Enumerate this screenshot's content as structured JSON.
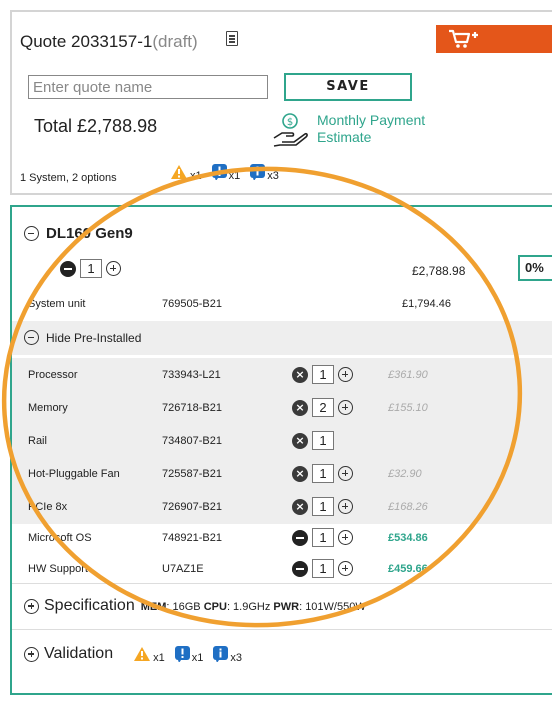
{
  "quote": {
    "title": "Quote 2033157-1",
    "draft": "(draft)",
    "name_placeholder": "Enter quote name",
    "name_value": "",
    "save_label": "SAVE",
    "total": "Total £2,788.98",
    "monthly_label": "Monthly Payment Estimate",
    "summary": "1 System, 2 options",
    "badges": [
      {
        "icon": "warning-icon",
        "count": "x1"
      },
      {
        "icon": "alert-icon",
        "count": "x1"
      },
      {
        "icon": "info-icon",
        "count": "x3"
      }
    ]
  },
  "system": {
    "name": "DL160 Gen9",
    "quantity": "1",
    "price": "£2,788.98",
    "discount": "0%",
    "system_unit": {
      "name": "System unit",
      "part": "769505-B21",
      "price": "£1,794.46"
    },
    "hide_label": "Hide Pre-Installed",
    "preinstalled": [
      {
        "name": "Processor",
        "part": "733943-L21",
        "qty": "1",
        "price": "£361.90"
      },
      {
        "name": "Memory",
        "part": "726718-B21",
        "qty": "2",
        "price": "£155.10"
      },
      {
        "name": "Rail",
        "part": "734807-B21",
        "qty": "1",
        "price": ""
      },
      {
        "name": "Hot-Pluggable Fan",
        "part": "725587-B21",
        "qty": "1",
        "price": "£32.90"
      },
      {
        "name": "PCIe 8x",
        "part": "726907-B21",
        "qty": "1",
        "price": "£168.26"
      }
    ],
    "options": [
      {
        "name": "Microsoft OS",
        "part": "748921-B21",
        "qty": "1",
        "price": "£534.86"
      },
      {
        "name": "HW Support",
        "part": "U7AZ1E",
        "qty": "1",
        "price": "£459.66"
      }
    ],
    "specification_label": "Specification",
    "spec": {
      "mem_label": "MEM",
      "mem_value": ": 16GB",
      "cpu_label": "CPU",
      "cpu_value": ": 1.9GHz",
      "pwr_label": "PWR",
      "pwr_value": ": 101W/550W"
    },
    "validation_label": "Validation",
    "validation_badges": [
      {
        "icon": "warning-icon",
        "count": "x1"
      },
      {
        "icon": "alert-icon",
        "count": "x1"
      },
      {
        "icon": "info-icon",
        "count": "x3"
      }
    ]
  },
  "colors": {
    "accent": "#2fa58c",
    "cart": "#e4561a",
    "annotation": "#f0a030",
    "warning": "#f5a623",
    "blue": "#1f6fc4"
  }
}
